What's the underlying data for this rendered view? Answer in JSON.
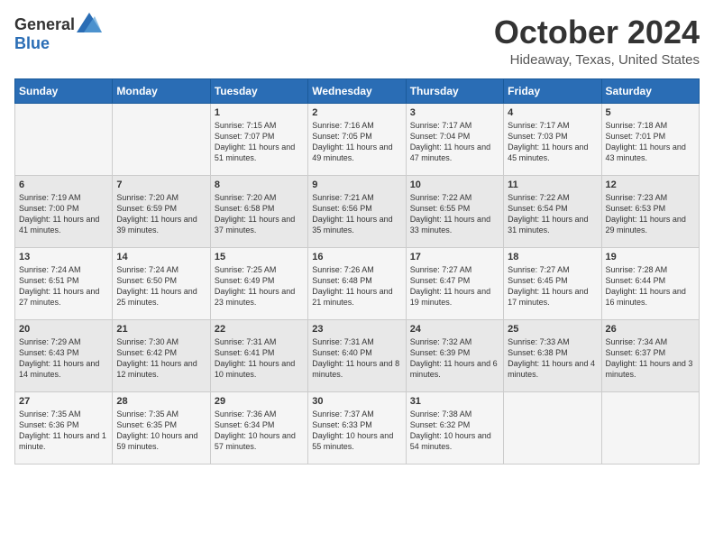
{
  "logo": {
    "general": "General",
    "blue": "Blue"
  },
  "title": "October 2024",
  "location": "Hideaway, Texas, United States",
  "days_of_week": [
    "Sunday",
    "Monday",
    "Tuesday",
    "Wednesday",
    "Thursday",
    "Friday",
    "Saturday"
  ],
  "weeks": [
    [
      {
        "day": "",
        "info": ""
      },
      {
        "day": "",
        "info": ""
      },
      {
        "day": "1",
        "info": "Sunrise: 7:15 AM\nSunset: 7:07 PM\nDaylight: 11 hours and 51 minutes."
      },
      {
        "day": "2",
        "info": "Sunrise: 7:16 AM\nSunset: 7:05 PM\nDaylight: 11 hours and 49 minutes."
      },
      {
        "day": "3",
        "info": "Sunrise: 7:17 AM\nSunset: 7:04 PM\nDaylight: 11 hours and 47 minutes."
      },
      {
        "day": "4",
        "info": "Sunrise: 7:17 AM\nSunset: 7:03 PM\nDaylight: 11 hours and 45 minutes."
      },
      {
        "day": "5",
        "info": "Sunrise: 7:18 AM\nSunset: 7:01 PM\nDaylight: 11 hours and 43 minutes."
      }
    ],
    [
      {
        "day": "6",
        "info": "Sunrise: 7:19 AM\nSunset: 7:00 PM\nDaylight: 11 hours and 41 minutes."
      },
      {
        "day": "7",
        "info": "Sunrise: 7:20 AM\nSunset: 6:59 PM\nDaylight: 11 hours and 39 minutes."
      },
      {
        "day": "8",
        "info": "Sunrise: 7:20 AM\nSunset: 6:58 PM\nDaylight: 11 hours and 37 minutes."
      },
      {
        "day": "9",
        "info": "Sunrise: 7:21 AM\nSunset: 6:56 PM\nDaylight: 11 hours and 35 minutes."
      },
      {
        "day": "10",
        "info": "Sunrise: 7:22 AM\nSunset: 6:55 PM\nDaylight: 11 hours and 33 minutes."
      },
      {
        "day": "11",
        "info": "Sunrise: 7:22 AM\nSunset: 6:54 PM\nDaylight: 11 hours and 31 minutes."
      },
      {
        "day": "12",
        "info": "Sunrise: 7:23 AM\nSunset: 6:53 PM\nDaylight: 11 hours and 29 minutes."
      }
    ],
    [
      {
        "day": "13",
        "info": "Sunrise: 7:24 AM\nSunset: 6:51 PM\nDaylight: 11 hours and 27 minutes."
      },
      {
        "day": "14",
        "info": "Sunrise: 7:24 AM\nSunset: 6:50 PM\nDaylight: 11 hours and 25 minutes."
      },
      {
        "day": "15",
        "info": "Sunrise: 7:25 AM\nSunset: 6:49 PM\nDaylight: 11 hours and 23 minutes."
      },
      {
        "day": "16",
        "info": "Sunrise: 7:26 AM\nSunset: 6:48 PM\nDaylight: 11 hours and 21 minutes."
      },
      {
        "day": "17",
        "info": "Sunrise: 7:27 AM\nSunset: 6:47 PM\nDaylight: 11 hours and 19 minutes."
      },
      {
        "day": "18",
        "info": "Sunrise: 7:27 AM\nSunset: 6:45 PM\nDaylight: 11 hours and 17 minutes."
      },
      {
        "day": "19",
        "info": "Sunrise: 7:28 AM\nSunset: 6:44 PM\nDaylight: 11 hours and 16 minutes."
      }
    ],
    [
      {
        "day": "20",
        "info": "Sunrise: 7:29 AM\nSunset: 6:43 PM\nDaylight: 11 hours and 14 minutes."
      },
      {
        "day": "21",
        "info": "Sunrise: 7:30 AM\nSunset: 6:42 PM\nDaylight: 11 hours and 12 minutes."
      },
      {
        "day": "22",
        "info": "Sunrise: 7:31 AM\nSunset: 6:41 PM\nDaylight: 11 hours and 10 minutes."
      },
      {
        "day": "23",
        "info": "Sunrise: 7:31 AM\nSunset: 6:40 PM\nDaylight: 11 hours and 8 minutes."
      },
      {
        "day": "24",
        "info": "Sunrise: 7:32 AM\nSunset: 6:39 PM\nDaylight: 11 hours and 6 minutes."
      },
      {
        "day": "25",
        "info": "Sunrise: 7:33 AM\nSunset: 6:38 PM\nDaylight: 11 hours and 4 minutes."
      },
      {
        "day": "26",
        "info": "Sunrise: 7:34 AM\nSunset: 6:37 PM\nDaylight: 11 hours and 3 minutes."
      }
    ],
    [
      {
        "day": "27",
        "info": "Sunrise: 7:35 AM\nSunset: 6:36 PM\nDaylight: 11 hours and 1 minute."
      },
      {
        "day": "28",
        "info": "Sunrise: 7:35 AM\nSunset: 6:35 PM\nDaylight: 10 hours and 59 minutes."
      },
      {
        "day": "29",
        "info": "Sunrise: 7:36 AM\nSunset: 6:34 PM\nDaylight: 10 hours and 57 minutes."
      },
      {
        "day": "30",
        "info": "Sunrise: 7:37 AM\nSunset: 6:33 PM\nDaylight: 10 hours and 55 minutes."
      },
      {
        "day": "31",
        "info": "Sunrise: 7:38 AM\nSunset: 6:32 PM\nDaylight: 10 hours and 54 minutes."
      },
      {
        "day": "",
        "info": ""
      },
      {
        "day": "",
        "info": ""
      }
    ]
  ]
}
